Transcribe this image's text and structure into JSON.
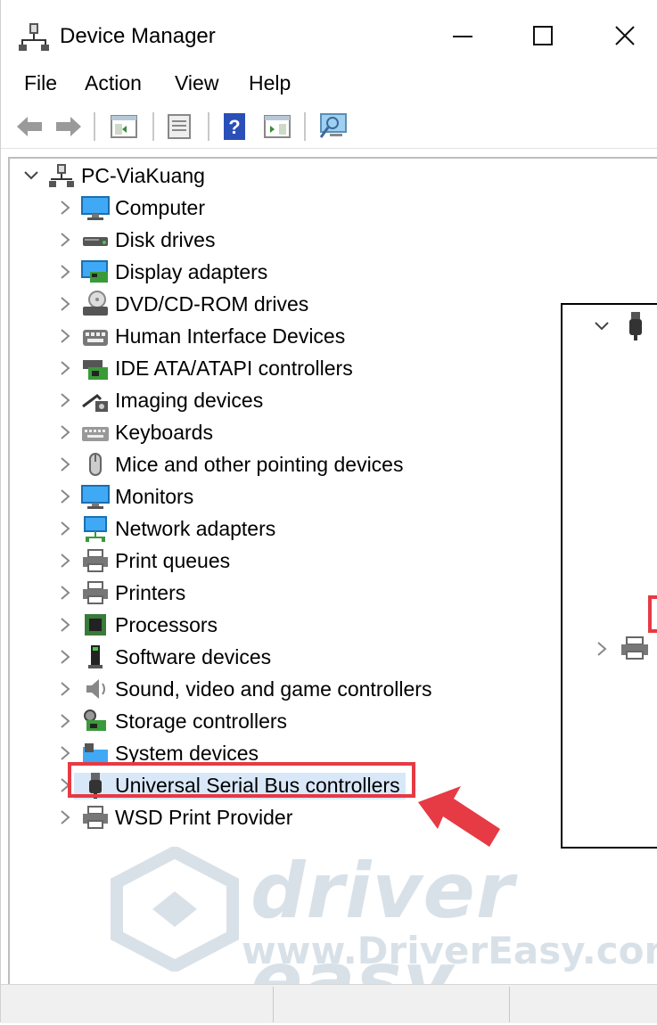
{
  "window": {
    "title": "Device Manager"
  },
  "menu": [
    "File",
    "Action",
    "View",
    "Help"
  ],
  "tree": {
    "root": "PC-ViaKuang",
    "items": [
      {
        "label": "Computer",
        "icon": "computer-icon"
      },
      {
        "label": "Disk drives",
        "icon": "disk-drive-icon"
      },
      {
        "label": "Display adapters",
        "icon": "display-adapter-icon"
      },
      {
        "label": "DVD/CD-ROM drives",
        "icon": "dvd-drive-icon"
      },
      {
        "label": "Human Interface Devices",
        "icon": "hid-icon"
      },
      {
        "label": "IDE ATA/ATAPI controllers",
        "icon": "ide-controller-icon"
      },
      {
        "label": "Imaging devices",
        "icon": "camera-icon"
      },
      {
        "label": "Keyboards",
        "icon": "keyboard-icon"
      },
      {
        "label": "Mice and other pointing devices",
        "icon": "mouse-icon"
      },
      {
        "label": "Monitors",
        "icon": "monitor-icon"
      },
      {
        "label": "Network adapters",
        "icon": "network-icon"
      },
      {
        "label": "Print queues",
        "icon": "printer-icon"
      },
      {
        "label": "Printers",
        "icon": "printer-icon"
      },
      {
        "label": "Processors",
        "icon": "processor-icon"
      },
      {
        "label": "Software devices",
        "icon": "software-device-icon"
      },
      {
        "label": "Sound, video and game controllers",
        "icon": "speaker-icon"
      },
      {
        "label": "Storage controllers",
        "icon": "storage-controller-icon"
      },
      {
        "label": "System devices",
        "icon": "system-folder-icon"
      },
      {
        "label": "Universal Serial Bus controllers",
        "icon": "usb-icon",
        "highlighted": true
      },
      {
        "label": "WSD Print Provider",
        "icon": "printer-icon"
      }
    ]
  },
  "watermark": {
    "brand": "driver easy",
    "url": "www.DriverEasy.com"
  },
  "colors": {
    "highlight": "#e63a44",
    "selection": "#d9e8f8",
    "watermark": "#8fa7bb"
  }
}
